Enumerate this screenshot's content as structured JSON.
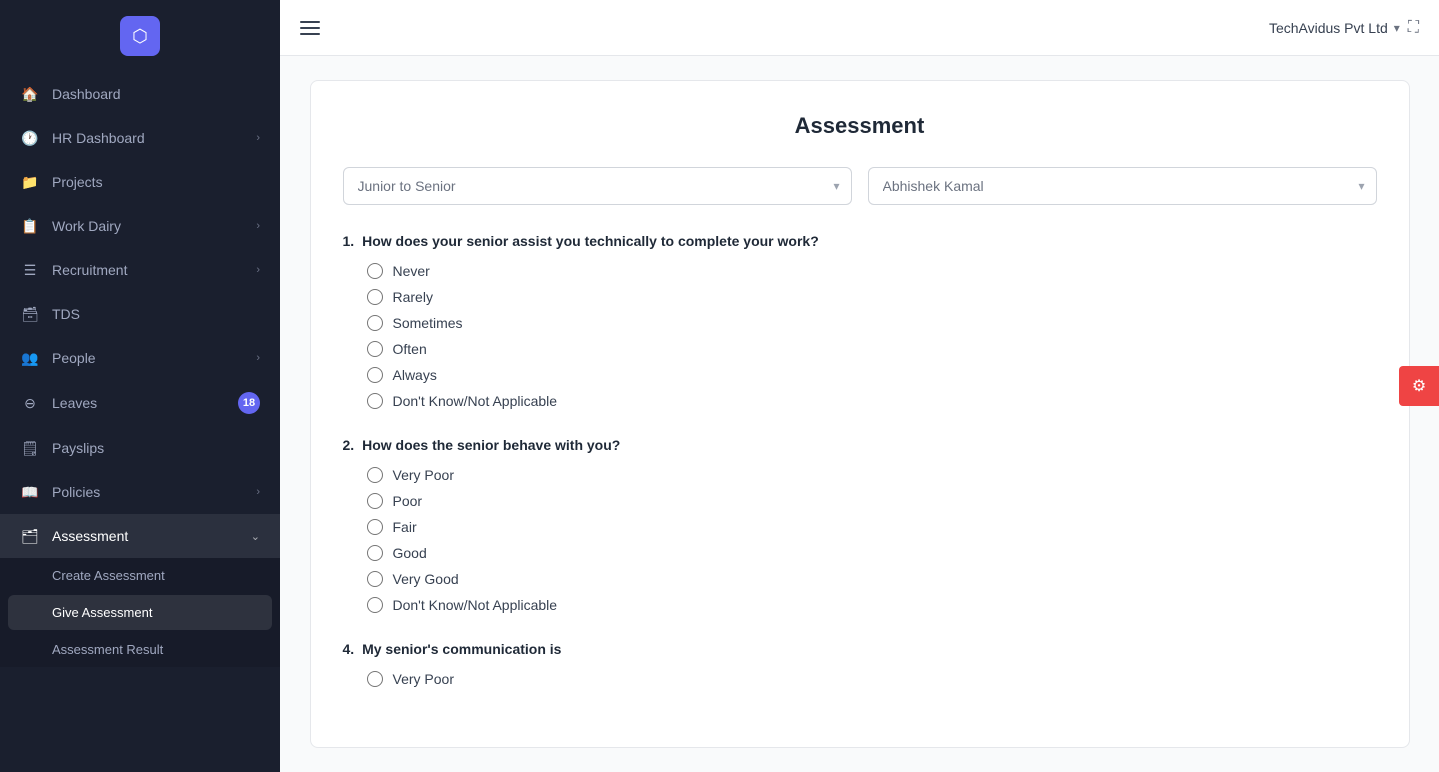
{
  "sidebar": {
    "logo": "⬡",
    "items": [
      {
        "id": "dashboard",
        "label": "Dashboard",
        "icon": "🏠",
        "hasChevron": false,
        "badge": null
      },
      {
        "id": "hr-dashboard",
        "label": "HR Dashboard",
        "icon": "🕐",
        "hasChevron": true,
        "badge": null
      },
      {
        "id": "projects",
        "label": "Projects",
        "icon": "📁",
        "hasChevron": false,
        "badge": null
      },
      {
        "id": "work-dairy",
        "label": "Work Dairy",
        "icon": "📋",
        "hasChevron": true,
        "badge": null
      },
      {
        "id": "recruitment",
        "label": "Recruitment",
        "icon": "☰",
        "hasChevron": true,
        "badge": null
      },
      {
        "id": "tds",
        "label": "TDS",
        "icon": "🗃",
        "hasChevron": false,
        "badge": null
      },
      {
        "id": "people",
        "label": "People",
        "icon": "👥",
        "hasChevron": true,
        "badge": null
      },
      {
        "id": "leaves",
        "label": "Leaves",
        "icon": "⊖",
        "hasChevron": false,
        "badge": "18"
      },
      {
        "id": "payslips",
        "label": "Payslips",
        "icon": "🗒",
        "hasChevron": false,
        "badge": null
      },
      {
        "id": "policies",
        "label": "Policies",
        "icon": "📖",
        "hasChevron": true,
        "badge": null
      },
      {
        "id": "assessment",
        "label": "Assessment",
        "icon": "🗂",
        "hasChevron": true,
        "badge": null,
        "expanded": true
      }
    ],
    "assessment_subitems": [
      {
        "id": "create-assessment",
        "label": "Create Assessment"
      },
      {
        "id": "give-assessment",
        "label": "Give Assessment"
      },
      {
        "id": "assessment-result",
        "label": "Assessment Result"
      }
    ]
  },
  "topbar": {
    "company": "TechAvidus Pvt Ltd",
    "expand_label": "⛶"
  },
  "assessment": {
    "title": "Assessment",
    "filter1_placeholder": "Junior to Senior",
    "filter2_placeholder": "Abhishek Kamal",
    "questions": [
      {
        "number": "1.",
        "text": "How does your senior assist you technically to complete your work?",
        "options": [
          "Never",
          "Rarely",
          "Sometimes",
          "Often",
          "Always",
          "Don't Know/Not Applicable"
        ]
      },
      {
        "number": "2.",
        "text": "How does the senior behave with you?",
        "options": [
          "Very Poor",
          "Poor",
          "Fair",
          "Good",
          "Very Good",
          "Don't Know/Not Applicable"
        ]
      },
      {
        "number": "4.",
        "text": "My senior's communication is",
        "options": [
          "Very Poor"
        ]
      }
    ]
  },
  "settings_fab": "⚙"
}
